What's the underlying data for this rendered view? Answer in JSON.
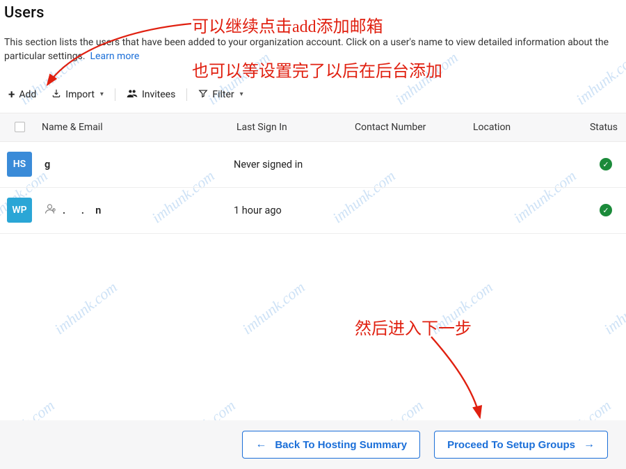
{
  "page": {
    "title": "Users",
    "description": "This section lists the users that have been added to your organization account. Click on a user's name to view detailed information about the particular settings.",
    "learn_more": "Learn more"
  },
  "toolbar": {
    "add": "Add",
    "import": "Import",
    "invitees": "Invitees",
    "filter": "Filter"
  },
  "table": {
    "headers": {
      "name_email": "Name & Email",
      "last_sign_in": "Last Sign In",
      "contact_number": "Contact Number",
      "location": "Location",
      "status": "Status"
    },
    "rows": [
      {
        "avatar_text": "HS",
        "avatar_class": "av-blue",
        "name_fragment": "g",
        "is_admin": false,
        "last_sign_in": "Never signed in",
        "contact_number": "",
        "location": "",
        "status": "ok"
      },
      {
        "avatar_text": "WP",
        "avatar_class": "av-cyan",
        "name_fragment": "n",
        "is_admin": true,
        "last_sign_in": "1 hour ago",
        "contact_number": "",
        "location": "",
        "status": "ok"
      }
    ]
  },
  "footer": {
    "back": "Back To Hosting Summary",
    "proceed": "Proceed To Setup Groups"
  },
  "annotations": {
    "a1": "可以继续点击add添加邮箱",
    "a2": "也可以等设置完了以后在后台添加",
    "a3": "然后进入下一步"
  },
  "watermark_text": "imhunk.com"
}
